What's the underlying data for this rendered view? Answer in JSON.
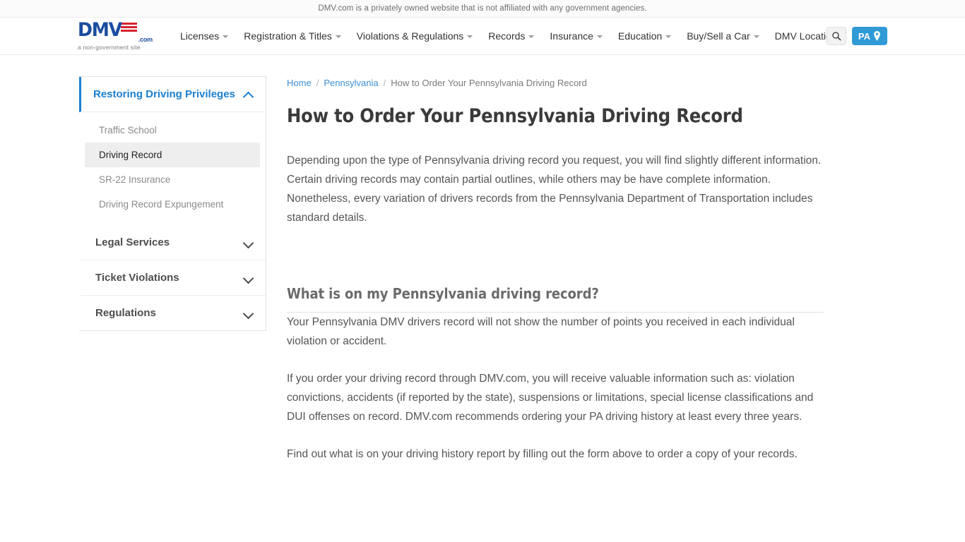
{
  "disclaimer": {
    "text": "DMV.com is a privately owned website that is not affiliated with any government agencies."
  },
  "header": {
    "logo": {
      "mark": "DMV",
      "dotcom": ".com",
      "tagline": "a non-government site"
    },
    "nav": [
      {
        "label": "Licenses",
        "has_dropdown": true
      },
      {
        "label": "Registration & Titles",
        "has_dropdown": true
      },
      {
        "label": "Violations & Regulations",
        "has_dropdown": true
      },
      {
        "label": "Records",
        "has_dropdown": true
      },
      {
        "label": "Insurance",
        "has_dropdown": true
      },
      {
        "label": "Education",
        "has_dropdown": true
      },
      {
        "label": "Buy/Sell a Car",
        "has_dropdown": true
      },
      {
        "label": "DMV Locations",
        "has_dropdown": false
      }
    ],
    "actions": {
      "search_icon": "search-icon",
      "state_label": "PA",
      "state_icon": "map-pin-icon",
      "state_button_color": "#2f9ad6"
    }
  },
  "sidebar": {
    "sections": [
      {
        "title": "Restoring Driving Privileges",
        "open": true,
        "chevron": "chevron-up-icon",
        "items": [
          {
            "label": "Traffic School",
            "active": false
          },
          {
            "label": "Driving Record",
            "active": true
          },
          {
            "label": "SR-22 Insurance",
            "active": false
          },
          {
            "label": "Driving Record Expungement",
            "active": false
          }
        ]
      },
      {
        "title": "Legal Services",
        "open": false,
        "chevron": "chevron-down-icon",
        "items": []
      },
      {
        "title": "Ticket Violations",
        "open": false,
        "chevron": "chevron-down-icon",
        "items": []
      },
      {
        "title": "Regulations",
        "open": false,
        "chevron": "chevron-down-icon",
        "items": []
      }
    ],
    "accent_color": "#1b7fd0"
  },
  "breadcrumb": {
    "home": "Home",
    "state": "Pennsylvania",
    "current": "How to Order Your Pennsylvania Driving Record",
    "separator": "/"
  },
  "main": {
    "title": "How to Order Your Pennsylvania Driving Record",
    "intro": "Depending upon the type of Pennsylvania driving record you request, you will find slightly different information. Certain driving records may contain partial outlines, while others may be have complete information. Nonetheless, every variation of drivers records from the Pennsylvania Department of Transportation includes standard details.",
    "section_title": "What is on my Pennsylvania driving record?",
    "paragraph_1": "Your Pennsylvania DMV drivers record will not show the number of points you received in each individual violation or accident.",
    "paragraph_2": "If you order your driving record through DMV.com, you will receive valuable information such as: violation convictions, accidents (if reported by the state), suspensions or limitations, special license classifications and DUI offenses on record. DMV.com recommends ordering your PA driving history at least every three years.",
    "paragraph_3": "Find out what is on your driving history report by filling out the form above to order a copy of your records."
  }
}
